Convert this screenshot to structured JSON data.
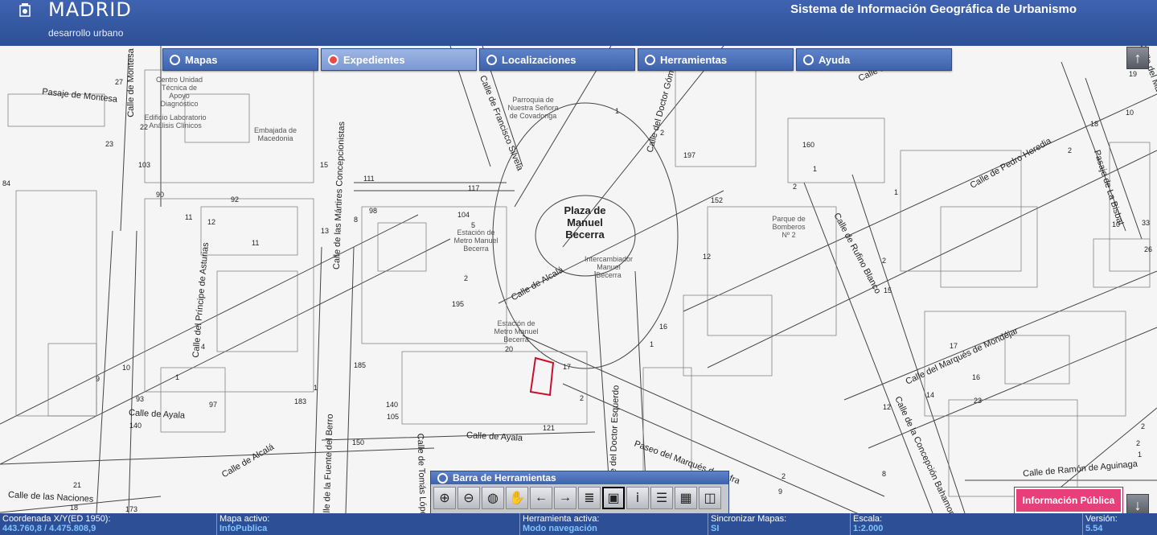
{
  "header": {
    "brand": "MADRID",
    "brand_sub": "desarrollo urbano",
    "system_title": "Sistema de Información Geográfica de Urbanismo"
  },
  "nav": {
    "tabs": [
      {
        "label": "Mapas",
        "active": false
      },
      {
        "label": "Expedientes",
        "active": true
      },
      {
        "label": "Localizaciones",
        "active": false
      },
      {
        "label": "Herramientas",
        "active": false
      },
      {
        "label": "Ayuda",
        "active": false
      }
    ]
  },
  "map": {
    "plaza": "Plaza de Manuel Becerra",
    "streets": [
      "Pasaje de Montesa",
      "Calle de Montesa",
      "Calle de Francisco Silvela",
      "Calle del Doctor Gómez",
      "Calle de Alcalá",
      "Calle de Alcalá",
      "Calle de Alcalá",
      "Calle de las Mártires Concepcionistas",
      "Calle del Príncipe de Asturias",
      "Calle de Ayala",
      "Calle de Ayala",
      "Calle de las Naciones",
      "Calle de la Fuente del Berro",
      "Calle de Tomás López",
      "Calle del Doctor Esquerdo",
      "Paseo del Marqués de Zafra",
      "Calle de Rufino Blanco",
      "Calle de Pedro Heredia",
      "Pasaje de La Bisbal",
      "Calle del Marqués de Mondéjar",
      "Calle de la Concepción Bahamonde",
      "Calle de Ramón de Aguinaga",
      "Calle del Maestro Alonso"
    ],
    "pois": [
      "Centro Unidad Técnica de Apoyo Diagnóstico",
      "Edificio Laboratorio Análisis Clínicos",
      "Embajada de Macedonia",
      "Parroquia de Nuestra Señora de Covadonga",
      "Estación de Metro Manuel Becerra",
      "Intercambiador Manuel Becerra",
      "Estación de Metro Manuel Becerra",
      "Parque de Bomberos Nº 2"
    ],
    "numbers": [
      "27",
      "22",
      "23",
      "103",
      "90",
      "11",
      "84",
      "92",
      "11",
      "13",
      "12",
      "15",
      "111",
      "117",
      "104",
      "8",
      "98",
      "5",
      "2",
      "195",
      "185",
      "20",
      "17",
      "2",
      "140",
      "105",
      "121",
      "97",
      "183",
      "93",
      "9",
      "10",
      "4",
      "1",
      "1",
      "150",
      "21",
      "18",
      "173",
      "140",
      "152",
      "160",
      "1",
      "197",
      "2",
      "1",
      "2",
      "12",
      "16",
      "1",
      "2",
      "15",
      "17",
      "16",
      "23",
      "14",
      "12",
      "8",
      "9",
      "2",
      "1",
      "19",
      "10",
      "18",
      "2",
      "10",
      "33",
      "26",
      "2",
      "1",
      "2"
    ]
  },
  "toolbar": {
    "title": "Barra de Herramientas",
    "buttons": [
      "zoom-in",
      "zoom-out",
      "globe",
      "hand-pan",
      "arrow-left",
      "arrow-right",
      "measure",
      "view-extent",
      "info",
      "legend",
      "grid",
      "layers"
    ]
  },
  "info_publica": "Información Pública",
  "status": {
    "coord_label": "Coordenada X/Y(ED 1950):",
    "coord_value": "443.760,8 / 4.475.808,9",
    "map_label": "Mapa activo:",
    "map_value": "InfoPublica",
    "tool_label": "Herramienta activa:",
    "tool_value": "Modo navegación",
    "sync_label": "Sincronizar Mapas:",
    "sync_value": "SI",
    "scale_label": "Escala:",
    "scale_value": "1:2.000",
    "version_label": "Versión:",
    "version_value": "5.54"
  },
  "colors": {
    "header": "#2d4f96",
    "accent": "#3e63ad",
    "info_publica": "#e83e7a",
    "selection": "#c8102e"
  }
}
